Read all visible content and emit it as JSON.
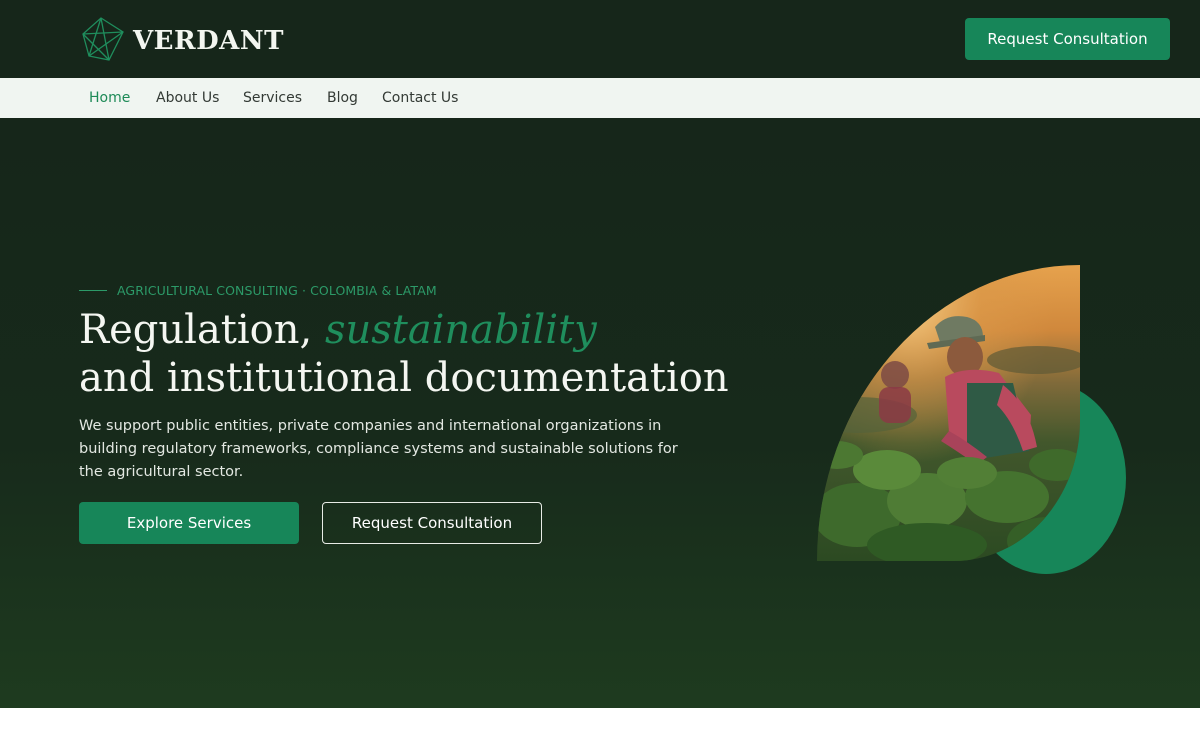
{
  "brand": {
    "name": "VERDANT",
    "logo_icon": "geometric-diamond-icon"
  },
  "header": {
    "cta_label": "Request Consultation"
  },
  "nav": {
    "items": [
      {
        "label": "Home",
        "active": true
      },
      {
        "label": "About Us",
        "active": false
      },
      {
        "label": "Services",
        "active": false
      },
      {
        "label": "Blog",
        "active": false
      },
      {
        "label": "Contact Us",
        "active": false
      }
    ]
  },
  "hero": {
    "eyebrow": "AGRICULTURAL CONSULTING · COLOMBIA & LATAM",
    "headline_part1": "Regulation, ",
    "headline_accent": "sustainability",
    "headline_part2": "and institutional documentation",
    "description": "We support public entities, private companies and international organizations in building regulatory frameworks, compliance systems and sustainable solutions for the agricultural sector.",
    "primary_button": "Explore Services",
    "secondary_button": "Request Consultation"
  },
  "colors": {
    "background_dark": "#16261a",
    "accent_green": "#178659",
    "nav_background": "#f0f5f1",
    "nav_active": "#1d8a57"
  }
}
